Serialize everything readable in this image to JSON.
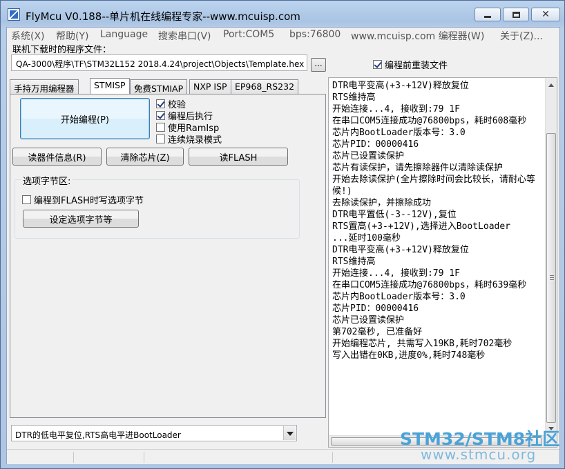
{
  "window": {
    "title": "FlyMcu V0.188--单片机在线编程专家--www.mcuisp.com"
  },
  "menu": [
    "系统(X)",
    "帮助(Y)",
    "Language",
    "搜索串口(V)",
    "Port:COM5",
    "bps:76800",
    "www.mcuisp.com 编程器(W)",
    "关于(Z)..."
  ],
  "file": {
    "label": "联机下载时的程序文件：",
    "path": "QA-3000\\程序\\TF\\STM32L152  2018.4.24\\project\\Objects\\Template.hex",
    "browse_label": "...",
    "reload_label": "编程前重装文件",
    "reload_checked": true
  },
  "tabs": [
    "手持万用编程器",
    "STMISP",
    "免费STMIAP",
    "NXP ISP",
    "EP968_RS232"
  ],
  "stmisp": {
    "start_label": "开始编程(P)",
    "options": [
      {
        "label": "校验",
        "checked": true
      },
      {
        "label": "编程后执行",
        "checked": true
      },
      {
        "label": "使用RamIsp",
        "checked": false
      },
      {
        "label": "连续烧录模式",
        "checked": false
      }
    ],
    "read_info_label": "读器件信息(R)",
    "erase_label": "清除芯片(Z)",
    "read_flash_label": "读FLASH",
    "option_group": {
      "title": "选项字节区:",
      "write_option_label": "编程到FLASH时写选项字节",
      "write_option_checked": false,
      "set_option_label": "设定选项字节等"
    },
    "reset_mode": "DTR的低电平复位,RTS高电平进BootLoader"
  },
  "log": [
    "DTR电平变高(+3-+12V)释放复位",
    "RTS维持高",
    "开始连接...4, 接收到:79 1F",
    "在串口COM5连接成功@76800bps，耗时608毫秒",
    "芯片内BootLoader版本号：3.0",
    "芯片PID：00000416",
    "芯片已设置读保护",
    "芯片有读保护，请先擦除器件以清除读保护",
    "开始去除读保护(全片擦除时间会比较长，请耐心等候!)",
    "去除读保护，并擦除成功",
    "DTR电平置低(-3--12V),复位",
    "RTS置高(+3-+12V),选择进入BootLoader",
    "...延时100毫秒",
    "DTR电平变高(+3-+12V)释放复位",
    "RTS维持高",
    "开始连接...4, 接收到:79 1F",
    "在串口COM5连接成功@76800bps，耗时639毫秒",
    "芯片内BootLoader版本号：3.0",
    "芯片PID：00000416",
    "芯片已设置读保护",
    "第702毫秒, 已准备好",
    "开始编程芯片, 共需写入19KB,耗时702毫秒",
    "写入出错在0KB,进度0%,耗时748毫秒"
  ],
  "watermark": {
    "title": "STM32/STM8社区",
    "url": "www.stmcu.org"
  }
}
